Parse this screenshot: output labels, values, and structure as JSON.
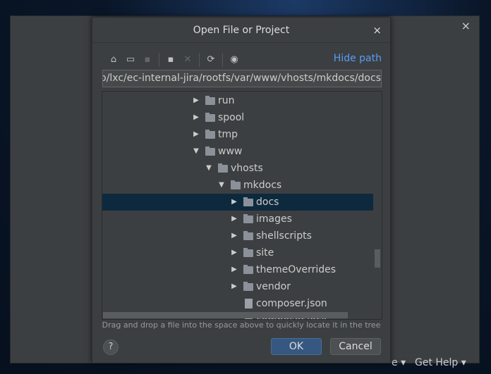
{
  "background_window": {
    "footer_partial": "e ▾",
    "get_help": "Get Help ▾",
    "close": "×"
  },
  "dialog": {
    "title": "Open File or Project",
    "close": "×",
    "toolbar": [
      {
        "icon": "home-icon",
        "glyph": "⌂"
      },
      {
        "icon": "desktop-icon",
        "glyph": "▭"
      },
      {
        "icon": "project-folder-icon",
        "glyph": "▪",
        "disabled": true
      },
      {
        "icon": "new-folder-icon",
        "glyph": "▪"
      },
      {
        "icon": "delete-icon",
        "glyph": "✕",
        "disabled": true
      },
      {
        "icon": "refresh-icon",
        "glyph": "⟳"
      },
      {
        "icon": "show-hidden-icon",
        "glyph": "◉"
      }
    ],
    "hide_path": "Hide path",
    "path": "/var/lib/lxc/ec-internal-jira/rootfs/var/www/vhosts/mkdocs/docs",
    "tree": [
      {
        "label": "run",
        "level": 0,
        "type": "folder",
        "expanded": false
      },
      {
        "label": "spool",
        "level": 0,
        "type": "folder",
        "expanded": false
      },
      {
        "label": "tmp",
        "level": 0,
        "type": "folder",
        "expanded": false
      },
      {
        "label": "www",
        "level": 0,
        "type": "folder",
        "expanded": true
      },
      {
        "label": "vhosts",
        "level": 1,
        "type": "folder",
        "expanded": true
      },
      {
        "label": "mkdocs",
        "level": 2,
        "type": "folder",
        "expanded": true
      },
      {
        "label": "docs",
        "level": 3,
        "type": "folder",
        "expanded": false,
        "selected": true
      },
      {
        "label": "images",
        "level": 3,
        "type": "folder",
        "expanded": false
      },
      {
        "label": "shellscripts",
        "level": 3,
        "type": "folder",
        "expanded": false
      },
      {
        "label": "site",
        "level": 3,
        "type": "folder",
        "expanded": false
      },
      {
        "label": "themeOverrides",
        "level": 3,
        "type": "folder",
        "expanded": false
      },
      {
        "label": "vendor",
        "level": 3,
        "type": "folder",
        "expanded": false
      },
      {
        "label": "composer.json",
        "level": 3,
        "type": "file"
      },
      {
        "label": "composer.lock",
        "level": 3,
        "type": "file"
      }
    ],
    "hint": "Drag and drop a file into the space above to quickly locate it in the tree",
    "help": "?",
    "ok": "OK",
    "cancel": "Cancel"
  }
}
